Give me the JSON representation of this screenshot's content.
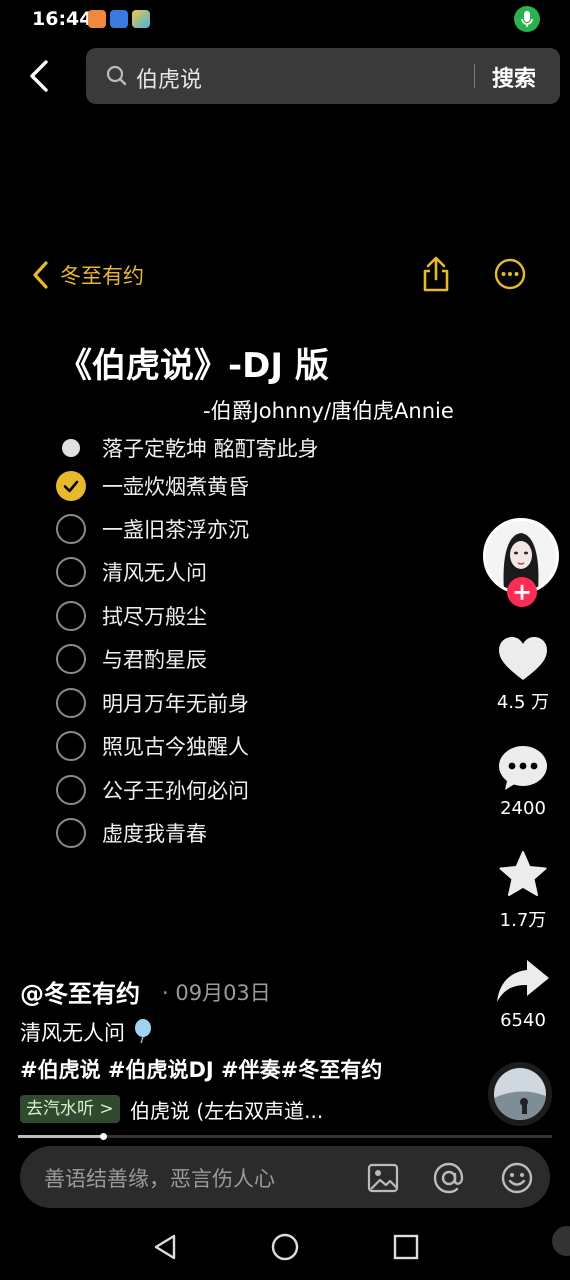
{
  "status_bar": {
    "time": "16:44"
  },
  "search": {
    "query": "伯虎说",
    "button": "搜索"
  },
  "note": {
    "back_label": "冬至有约",
    "title": "《伯虎说》-DJ 版",
    "author": "-伯爵Johnny/唐伯虎Annie",
    "items": [
      {
        "text": "落子定乾坤 酩酊寄此身",
        "state": "current"
      },
      {
        "text": "一壶炊烟煮黄昏",
        "state": "checked"
      },
      {
        "text": "一盏旧茶浮亦沉",
        "state": "unchecked"
      },
      {
        "text": "清风无人问",
        "state": "unchecked"
      },
      {
        "text": "拭尽万般尘",
        "state": "unchecked"
      },
      {
        "text": "与君酌星辰",
        "state": "unchecked"
      },
      {
        "text": "明月万年无前身",
        "state": "unchecked"
      },
      {
        "text": "照见古今独醒人",
        "state": "unchecked"
      },
      {
        "text": "公子王孙何必问",
        "state": "unchecked"
      },
      {
        "text": "虚度我青春",
        "state": "unchecked"
      }
    ]
  },
  "actions": {
    "likes": "4.5 万",
    "comments": "2400",
    "favorites": "1.7万",
    "shares": "6540"
  },
  "post": {
    "author": "@冬至有约",
    "date": "· 09月03日",
    "caption": "清风无人问",
    "tags": "#伯虎说 #伯虎说DJ #伴奏#冬至有约",
    "music_tag": "去汽水听 >",
    "music_name": "伯虎说 (左右双声道..."
  },
  "comment_input": {
    "placeholder": "善语结善缘，恶言伤人心"
  },
  "colors": {
    "accent": "#e8b92c",
    "follow": "#fe2c55",
    "background": "#000000"
  },
  "playback_progress": 0.16
}
